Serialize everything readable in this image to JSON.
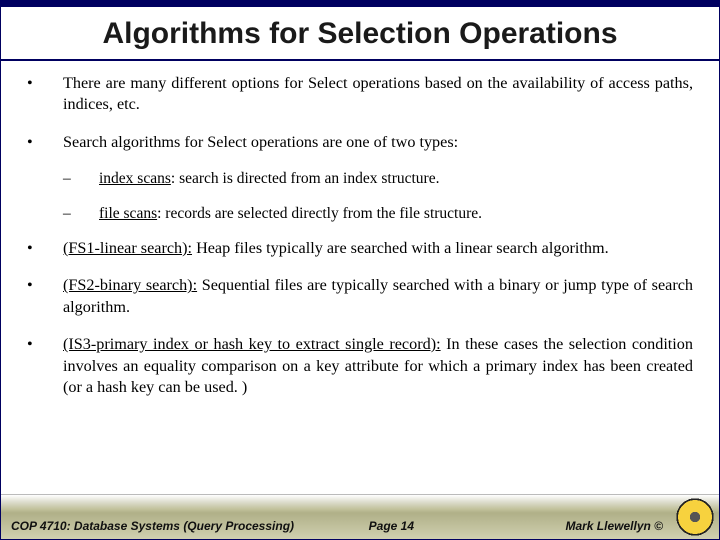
{
  "title": "Algorithms for Selection Operations",
  "bullets": {
    "b1": "There are many different options for Select operations based on the availability of access paths, indices, etc.",
    "b2": "Search algorithms for Select operations are one of two types:",
    "s1_term": "index scans",
    "s1_rest": ": search is directed from an index structure.",
    "s2_term": "file scans",
    "s2_rest": ": records are selected directly from the file structure.",
    "b3_u": "(FS1-linear search):",
    "b3_rest": " Heap files typically are searched with a linear search algorithm.",
    "b4_u": "(FS2-binary search):",
    "b4_rest": " Sequential files are typically searched with a binary or jump type of search algorithm.",
    "b5_u": "(IS3-primary index or hash key to extract single record):",
    "b5_rest": " In these cases the selection condition involves an equality comparison on a key attribute for which a primary index has been created (or a hash key can be used. )"
  },
  "footer": {
    "left": "COP 4710: Database Systems (Query Processing)",
    "mid": "Page 14",
    "right": "Mark Llewellyn ©"
  }
}
